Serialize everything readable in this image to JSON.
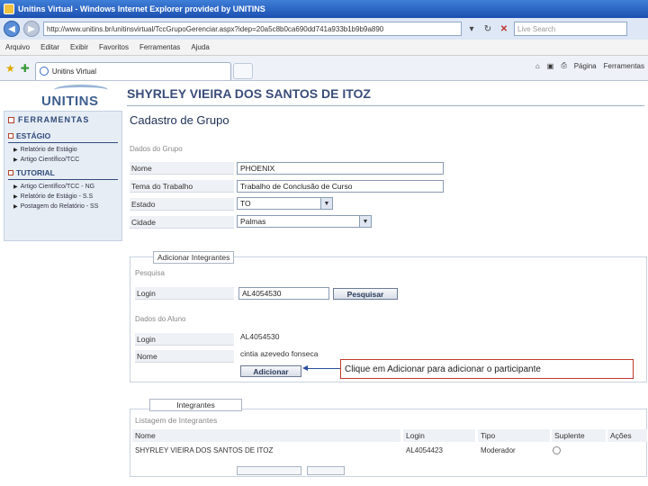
{
  "browser": {
    "title": "Unitins Virtual - Windows Internet Explorer provided by UNITINS",
    "url": "http://www.unitins.br/unitinsvirtual/TccGrupoGerenciar.aspx?idep=20a5c8b0ca690dd741a933b1b9b9a890",
    "search_placeholder": "Live Search",
    "menu": [
      "Arquivo",
      "Editar",
      "Exibir",
      "Favoritos",
      "Ferramentas",
      "Ajuda"
    ],
    "tab_label": "Unitins Virtual",
    "cmd": [
      "Página",
      "Ferramentas"
    ]
  },
  "header": {
    "logo": "UNITINS",
    "user_name": "SHYRLEY VIEIRA DOS SANTOS DE ITOZ"
  },
  "sidebar": {
    "title": "FERRAMENTAS",
    "sections": [
      {
        "label": "ESTÁGIO",
        "items": [
          "Relatório de Estágio",
          "Artigo Científico/TCC"
        ]
      },
      {
        "label": "TUTORIAL",
        "items": [
          "Artigo Científico/TCC - NG",
          "Relatório de Estágio - S.S",
          "Postagem do Relatório - SS"
        ]
      }
    ]
  },
  "form": {
    "title": "Cadastro de Grupo",
    "group_section": "Dados do Grupo",
    "nome_label": "Nome",
    "nome_value": "PHOENIX",
    "tema_label": "Tema do Trabalho",
    "tema_value": "Trabalho de Conclusão de Curso",
    "estado_label": "Estado",
    "estado_value": "TO",
    "cidade_label": "Cidade",
    "cidade_value": "Palmas",
    "add_legend": "Adicionar Integrantes",
    "pesquisa_label": "Pesquisa",
    "login_label": "Login",
    "login_input": "AL4054530",
    "pesquisar_button": "Pesquisar",
    "aluno_section": "Dados do Aluno",
    "aluno_login_label": "Login",
    "aluno_login_value": "AL4054530",
    "aluno_nome_label": "Nome",
    "aluno_nome_value": "cintia azevedo fonseca",
    "adicionar_button": "Adicionar",
    "callout": "Clique em Adicionar para adicionar o participante"
  },
  "integrantes": {
    "legend": "Integrantes",
    "list_title": "Listagem de Integrantes",
    "columns": [
      "Nome",
      "Login",
      "Tipo",
      "Suplente",
      "Ações"
    ],
    "rows": [
      {
        "nome": "SHYRLEY VIEIRA DOS SANTOS DE ITOZ",
        "login": "AL4054423",
        "tipo": "Moderador"
      }
    ]
  }
}
